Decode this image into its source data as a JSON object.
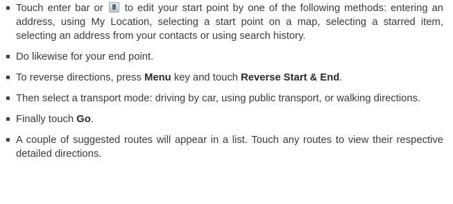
{
  "items": [
    {
      "before_icon": "Touch enter bar or",
      "icon": "address-book-icon",
      "after_icon": "to edit your start point by one of the following methods: entering an address, using My Location, selecting a start point on a map, selecting a starred item, selecting an address from your contacts or using search history."
    },
    {
      "text": "Do likewise for your end point."
    },
    {
      "t1": "To reverse directions, press",
      "b1": "Menu",
      "t2": "key and touch",
      "b2": "Reverse Start & End",
      "t3": "."
    },
    {
      "text": "Then select a transport mode: driving by car, using public transport, or walking directions."
    },
    {
      "t1": "Finally touch",
      "b1": "Go",
      "t2": "."
    },
    {
      "text": "A couple of suggested routes will appear in a list. Touch any routes to view their respective detailed directions."
    }
  ]
}
